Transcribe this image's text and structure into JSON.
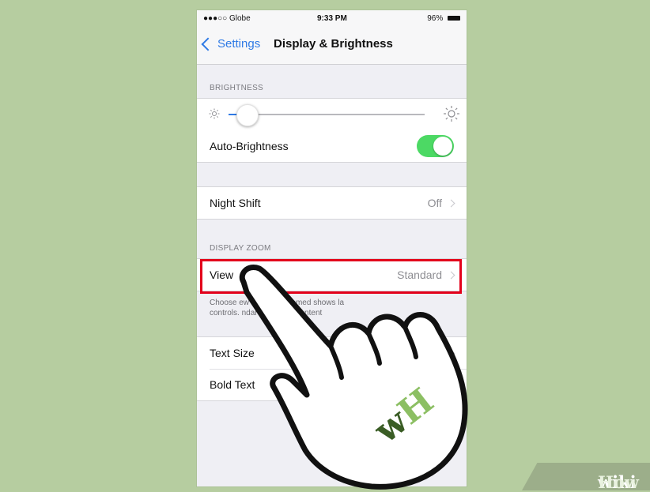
{
  "status_bar": {
    "carrier": "●●●○○ Globe",
    "time": "9:33 PM",
    "battery": "96%"
  },
  "nav": {
    "back_label": "Settings",
    "title": "Display & Brightness"
  },
  "brightness": {
    "header": "BRIGHTNESS",
    "slider_level": 0.1,
    "auto_label": "Auto-Brightness",
    "auto_on": true
  },
  "night_shift": {
    "label": "Night Shift",
    "value": "Off"
  },
  "display_zoom": {
    "header": "DISPLAY ZOOM",
    "view_label": "View",
    "view_value": "Standard",
    "footer_line1": "Choose      ew fo     hone. Zoomed shows la",
    "footer_line2": "controls.      ndard      ws more content"
  },
  "text": {
    "text_size_label": "Text Size",
    "bold_text_label": "Bold Text"
  },
  "overlay": {
    "hand_badge": "wH",
    "watermark_wiki": "wiki",
    "watermark_how": "How"
  },
  "colors": {
    "accent": "#2f7ae5",
    "toggle_on": "#4cd964",
    "highlight": "#e3001b",
    "background": "#b6cda0",
    "wikihow_green": "#5d8a3e"
  }
}
